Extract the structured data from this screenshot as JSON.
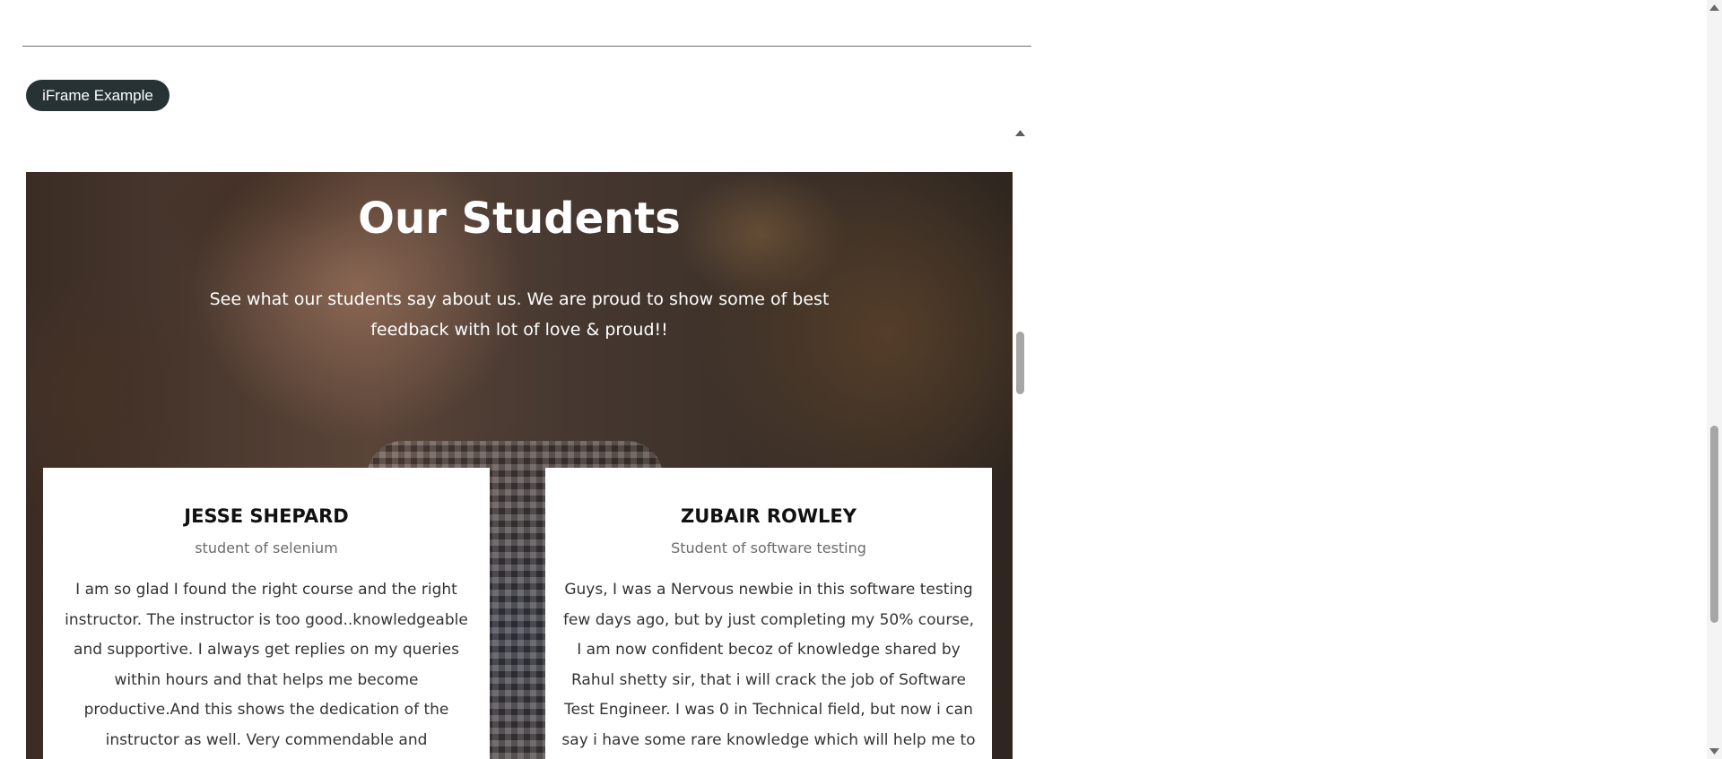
{
  "section": {
    "badge_label": "iFrame Example"
  },
  "iframe": {
    "hero": {
      "title": "Our Students",
      "subtitle": "See what our students say about us. We are proud to show some of best feedback with lot of love & proud!!"
    },
    "testimonials": [
      {
        "name": "JESSE SHEPARD",
        "role": "student of selenium",
        "quote": "I am so glad I found the right course and the right instructor. The instructor is too good..knowledgeable and supportive. I always get replies on my queries within hours and that helps me become productive.And this shows the dedication of the instructor as well. Very commendable and exceptional and elaborate"
      },
      {
        "name": "ZUBAIR ROWLEY",
        "role": "Student of software testing",
        "quote": "Guys, I was a Nervous newbie in this software testing few days ago, but by just completing my 50% course, I am now confident becoz of knowledge shared by Rahul shetty sir, that i will crack the job of Software Test Engineer. I was 0 in Technical field, but now i can say i have some rare knowledge which will help me to deal with my goals and challenges in"
      }
    ]
  },
  "icons": {
    "scroll_up": "triangle-up-icon",
    "scroll_down": "triangle-down-icon"
  },
  "colors": {
    "badge_background": "#263234",
    "scrollbar_thumb": "#a6a6a6"
  }
}
